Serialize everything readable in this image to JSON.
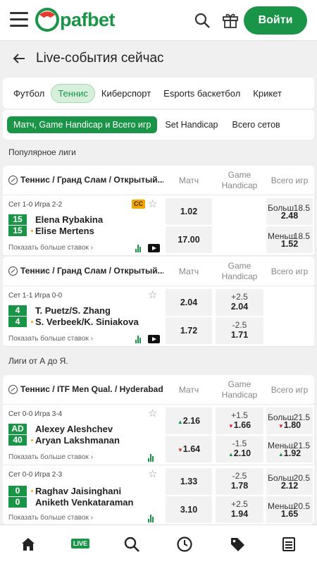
{
  "header": {
    "logo_text": "pafbet",
    "login_label": "Войти"
  },
  "page_title": "Live-события сейчас",
  "sports_tabs": [
    {
      "label": "Футбол",
      "active": false
    },
    {
      "label": "Теннис",
      "active": true
    },
    {
      "label": "Киберспорт",
      "active": false
    },
    {
      "label": "Esports баскетбол",
      "active": false
    },
    {
      "label": "Крикет",
      "active": false
    }
  ],
  "market_filters": [
    {
      "label": "Матч, Game Handicap и Всего игр",
      "active": true
    },
    {
      "label": "Set Handicap",
      "active": false
    },
    {
      "label": "Всего сетов",
      "active": false
    }
  ],
  "sections": {
    "popular": "Популярное лиги",
    "az": "Лиги от А до Я."
  },
  "columns": {
    "match": "Матч",
    "game_handicap_1": "Game",
    "game_handicap_2": "Handicap",
    "total": "Всего игр"
  },
  "leagues": [
    {
      "name": "Теннис / Гранд Слам / Открытый...",
      "matches": [
        {
          "info": "Сет 1-0 Игра 2-2",
          "badge": "CC",
          "p1": "Elena Rybakina",
          "p2": "Elise Mertens",
          "s1": "15",
          "s2": "15",
          "m1": "1.02",
          "m2": "17.00",
          "t1h": "Больш",
          "t1v": "18.5",
          "t1o": "2.48",
          "t2h": "Меньш",
          "t2v": "18.5",
          "t2o": "1.52"
        }
      ]
    },
    {
      "name": "Теннис / Гранд Слам / Открытый...",
      "matches": [
        {
          "info": "Сет 1-1 Игра 0-0",
          "p1": "T. Puetz/S. Zhang",
          "p2": "S. Verbeek/K. Siniakova",
          "s1": "4",
          "s2": "4",
          "m1": "2.04",
          "m2": "1.72",
          "h1h": "+2.5",
          "h1o": "2.04",
          "h2h": "-2.5",
          "h2o": "1.71"
        }
      ]
    },
    {
      "name": "Теннис / ITF Men Qual. / Hyderabad",
      "matches": [
        {
          "info": "Сет 0-0 Игра 3-4",
          "p1": "Alexey Aleshchev",
          "p2": "Aryan Lakshmanan",
          "s1": "AD",
          "s2": "40",
          "m1": "2.16",
          "m2": "1.64",
          "h1h": "+1.5",
          "h1o": "1.66",
          "h2h": "-1.5",
          "h2o": "2.10",
          "t1h": "Больш",
          "t1v": "21.5",
          "t1o": "1.80",
          "t2h": "Меньш",
          "t2v": "21.5",
          "t2o": "1.92"
        },
        {
          "info": "Сет 0-0 Игра 2-3",
          "p1": "Raghav Jaisinghani",
          "p2": "Aniketh Venkataraman",
          "s1": "0",
          "s2": "0",
          "m1": "1.33",
          "m2": "3.10",
          "h1h": "-2.5",
          "h1o": "1.78",
          "h2h": "+2.5",
          "h2o": "1.94",
          "t1h": "Больш",
          "t1v": "20.5",
          "t1o": "2.12",
          "t2h": "Меньш",
          "t2v": "20.5",
          "t2o": "1.65"
        }
      ]
    }
  ],
  "more_bets": "Показать больше ставок ›",
  "bottom_nav": {
    "live_label": "LIVE"
  },
  "colors": {
    "brand": "#1a9447",
    "up": "#1a9447",
    "down": "#d52a2a",
    "badge": "#f5a400"
  }
}
